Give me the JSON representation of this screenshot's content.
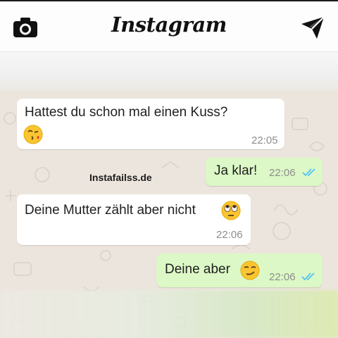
{
  "header": {
    "title": "Instagram",
    "camera_icon": "camera-icon",
    "send_icon": "direct-send-icon"
  },
  "watermark": "Instafailss.de",
  "messages": [
    {
      "direction": "incoming",
      "text": "Hattest du schon mal einen Kuss?",
      "emoji": "face-blowing-kiss",
      "time": "22:05"
    },
    {
      "direction": "outgoing",
      "text": "Ja klar!",
      "time": "22:06",
      "status": "read-double-check"
    },
    {
      "direction": "incoming",
      "text": "Deine Mutter zählt aber nicht",
      "emoji": "face-with-rolling-eyes",
      "time": "22:06"
    },
    {
      "direction": "outgoing",
      "text": "Deine aber",
      "emoji": "smirking-face",
      "time": "22:06",
      "status": "read-double-check"
    }
  ],
  "colors": {
    "incoming_bubble": "#ffffff",
    "outgoing_bubble": "#dcf8c6",
    "chat_background": "#ece5dd",
    "read_ticks": "#4fc3f7",
    "timestamp": "#8d8d8d"
  }
}
